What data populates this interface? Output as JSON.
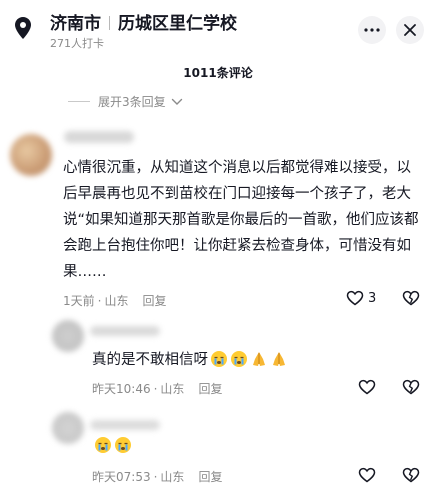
{
  "header": {
    "city": "济南市",
    "place": "历城区里仁学校",
    "checkins": "271人打卡",
    "icons": {
      "location": "location-pin-icon",
      "more": "more-dots-icon",
      "close": "close-icon"
    }
  },
  "comments_header": {
    "count_label": "1011条评论"
  },
  "expand_replies": {
    "label": "展开3条回复"
  },
  "comment_main": {
    "text": "心情很沉重，从知道这个消息以后都觉得难以接受，以后早晨再也见不到苗校在门口迎接每一个孩子了，老大说“如果知道那天那首歌是你最后的一首歌，他们应该都会跑上台抱住你吧！让你赶紧去检查身体，可惜没有如果……",
    "time": "1天前",
    "location": "山东",
    "reply_label": "回复",
    "likes": "3"
  },
  "replies": [
    {
      "text": "真的是不敢相信呀",
      "emojis": [
        "crying-face-emoji",
        "crying-face-emoji",
        "praying-hands-emoji",
        "praying-hands-emoji"
      ],
      "time": "昨天10:46",
      "location": "山东",
      "reply_label": "回复"
    },
    {
      "text": "",
      "emojis": [
        "crying-face-emoji",
        "crying-face-emoji"
      ],
      "time": "昨天07:53",
      "location": "山东",
      "reply_label": "回复"
    }
  ],
  "colors": {
    "text": "#161823",
    "secondary": "#8a8a8a",
    "background": "#ffffff"
  }
}
